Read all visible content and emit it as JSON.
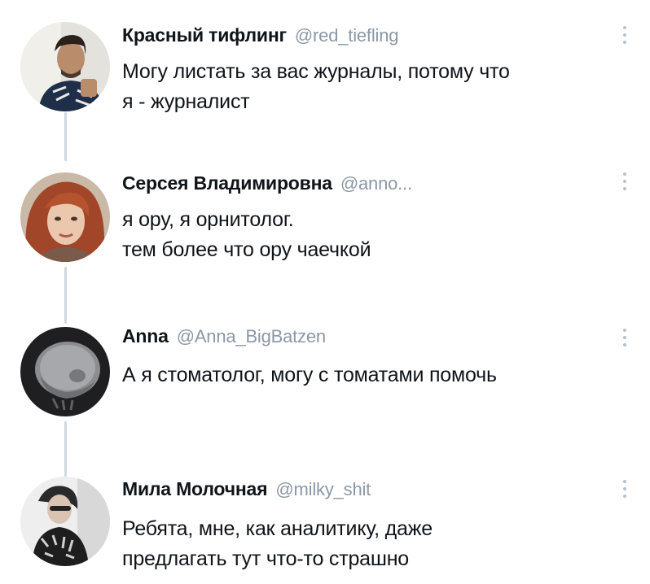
{
  "tweets": [
    {
      "name": "Красный тифлинг",
      "handle": "@red_tiefling",
      "lines": [
        "Могу листать за вас журналы, потому что",
        "я - журналист"
      ],
      "avatar_icon": "profile-photo-man-icon",
      "more_icon": "more-options-icon"
    },
    {
      "name": "Серсея Владимировна",
      "handle": "@anno...",
      "lines": [
        "я ору, я орнитолог.",
        "тем более что ору чаечкой"
      ],
      "avatar_icon": "profile-photo-redhead-woman-icon",
      "more_icon": "more-options-icon"
    },
    {
      "name": "Anna",
      "handle": "@Anna_BigBatzen",
      "lines": [
        "А я стоматолог, могу с томатами помочь"
      ],
      "avatar_icon": "profile-photo-skull-xray-icon",
      "more_icon": "more-options-icon"
    },
    {
      "name": "Мила Молочная",
      "handle": "@milky_shit",
      "lines": [
        "Ребята, мне, как аналитику, даже",
        "предлагать тут что-то страшно"
      ],
      "avatar_icon": "profile-photo-woman-icon",
      "more_icon": "more-options-icon"
    }
  ],
  "colors": {
    "name": "#0f1419",
    "handle": "#8b98a5",
    "thread_line": "#cfd9de",
    "more_dots": "#b8c2cb"
  }
}
